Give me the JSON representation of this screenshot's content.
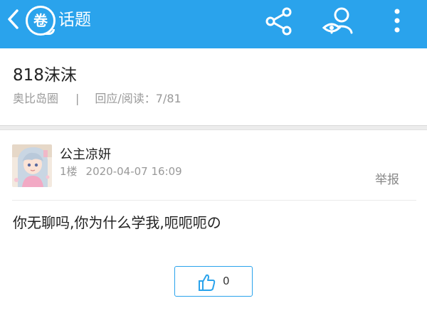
{
  "header": {
    "logo_char": "卷",
    "title": "话题",
    "icons": {
      "back": "chevron-left-icon",
      "share": "share-icon",
      "user": "user-eye-icon",
      "more": "more-vertical-icon"
    },
    "bar_color": "#2aa3ec"
  },
  "post": {
    "title": "818沫沫",
    "circle": "奥比岛圈",
    "separator": "|",
    "replies_views": "回应/阅读：7/81"
  },
  "reply": {
    "author": "公主凉妍",
    "floor": "1楼",
    "date": "2020-04-07 16:09",
    "report_label": "举报",
    "content": "你无聊吗,你为什么学我,呃呃呃の",
    "like_count": "0",
    "like_icon": "thumbs-up-icon"
  }
}
